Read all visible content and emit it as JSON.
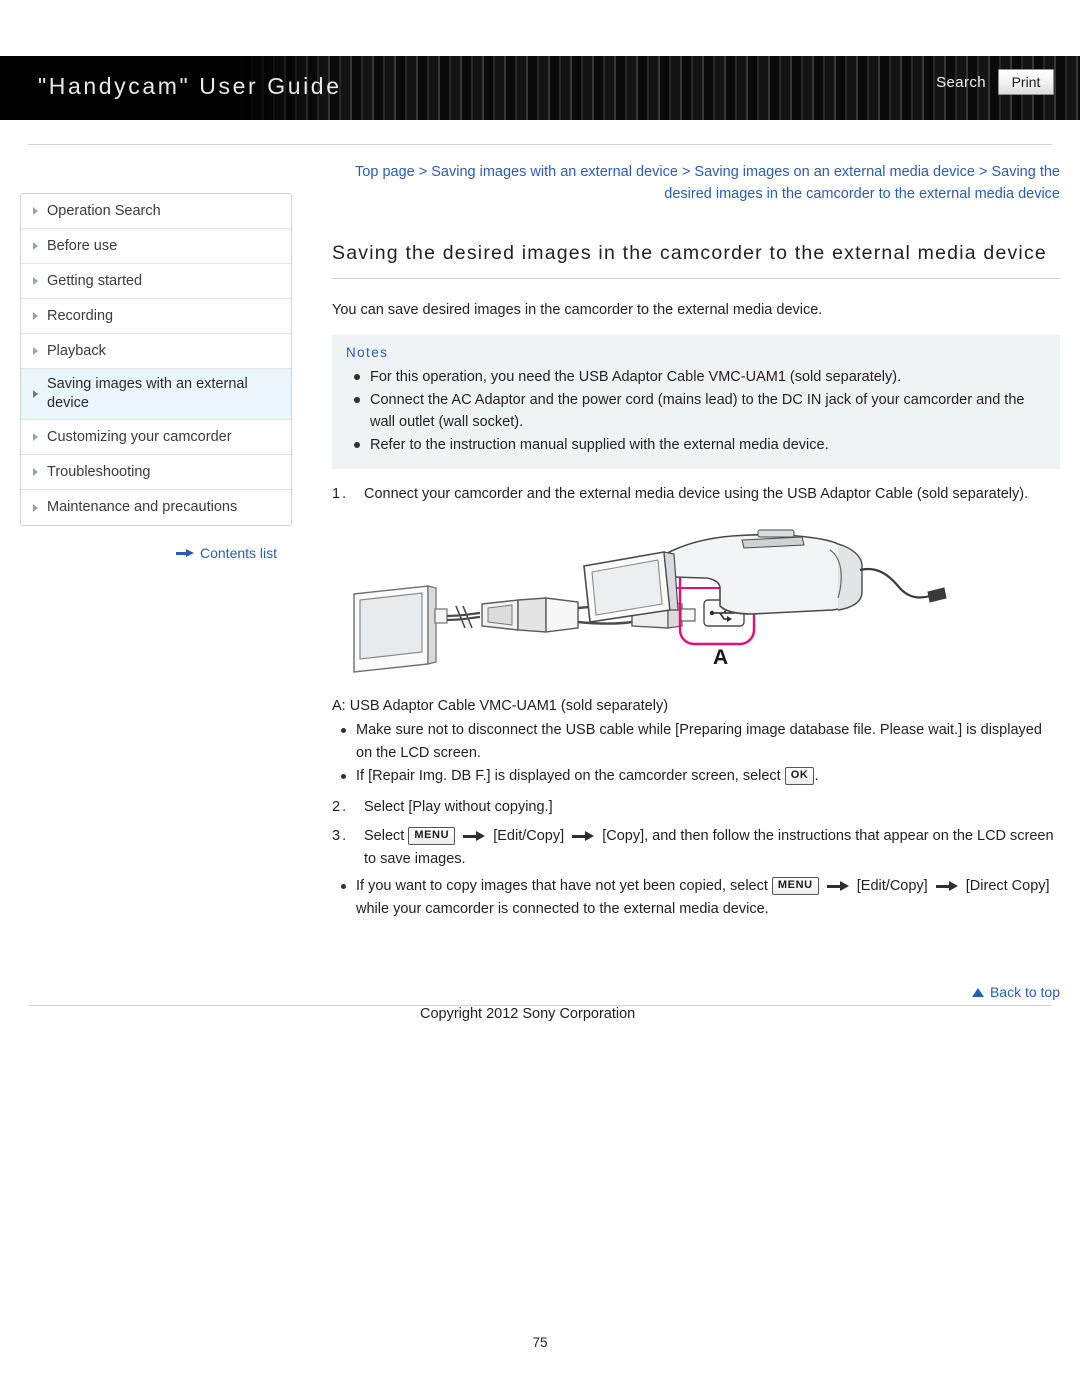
{
  "header": {
    "title": "\"Handycam\" User Guide",
    "search_label": "Search",
    "print_label": "Print"
  },
  "breadcrumb": {
    "line1_part1": "Top page",
    "line1_part2": "Saving images with an external device",
    "line1_part3": "Saving images on an external media",
    "line2_part1": "device",
    "line2_part2": "Saving the desired images in the camcorder to the external media device",
    "separator": ">"
  },
  "sidebar": {
    "items": [
      {
        "label": "Operation Search",
        "active": false
      },
      {
        "label": "Before use",
        "active": false
      },
      {
        "label": "Getting started",
        "active": false
      },
      {
        "label": "Recording",
        "active": false
      },
      {
        "label": "Playback",
        "active": false
      },
      {
        "label": "Saving images with an external device",
        "active": true
      },
      {
        "label": "Customizing your camcorder",
        "active": false
      },
      {
        "label": "Troubleshooting",
        "active": false
      },
      {
        "label": "Maintenance and precautions",
        "active": false
      }
    ],
    "contents_list_label": "Contents list"
  },
  "main": {
    "title": "Saving the desired images in the camcorder to the external media device",
    "intro": "You can save desired images in the camcorder to the external media device.",
    "notes_title": "Notes",
    "notes": [
      "For this operation, you need the USB Adaptor Cable VMC-UAM1 (sold separately).",
      "Connect the AC Adaptor and the power cord (mains lead) to the DC IN jack of your camcorder and the wall outlet (wall socket).",
      "Refer to the instruction manual supplied with the external media device."
    ],
    "step1": {
      "num": "1.",
      "text": "Connect your camcorder and the external media device using the USB Adaptor Cable (sold separately)."
    },
    "figure": {
      "callout_letter": "A",
      "usb_icon_name": "usb-icon"
    },
    "caption_a": "A: USB Adaptor Cable VMC-UAM1 (sold separately)",
    "step1_subs": [
      "Make sure not to disconnect the USB cable while [Preparing image database file. Please wait.] is displayed on the LCD screen."
    ],
    "step1_sub_repair_pre": "If [Repair Img. DB F.] is displayed on the camcorder screen, select",
    "step1_sub_repair_key": "OK",
    "step1_sub_repair_post": ".",
    "step2": {
      "num": "2.",
      "text": "Select [Play without copying.]"
    },
    "step3": {
      "num": "3.",
      "pre": "Select",
      "key_menu": "MENU",
      "mid1": "[Edit/Copy]",
      "mid2": "[Copy], and then follow the instructions that appear on the LCD screen to save images."
    },
    "step3_sub": {
      "pre": "If you want to copy images that have not yet been copied, select",
      "key_menu": "MENU",
      "mid": "[Edit/Copy]",
      "post": "[Direct Copy] while your camcorder is connected to the external media device."
    }
  },
  "footer": {
    "back_to_top": "Back to top",
    "copyright": "Copyright 2012 Sony Corporation",
    "page_number": "75"
  },
  "colors": {
    "link": "#2a5db0",
    "notes_bg": "#eff3f6",
    "sidebar_active_bg": "#eaf6fb",
    "callout": "#ec0b74"
  }
}
